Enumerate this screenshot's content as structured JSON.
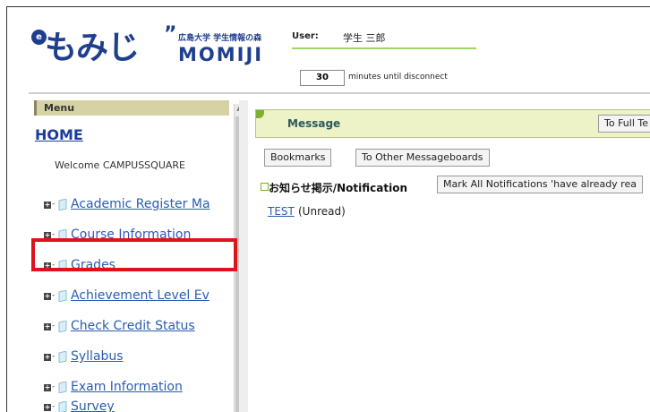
{
  "header": {
    "logo_mark": "e",
    "logo_kana": "もみじ",
    "logo_quote": "”",
    "logo_sub": "広島大学 学生情報の森",
    "logo_en": "MOMIJI",
    "user_label": "User:",
    "user_name": "学生 三郎",
    "timer_value": "30",
    "timer_text": "minutes until disconnect"
  },
  "sidebar": {
    "menu_title": "Menu",
    "home": "HOME",
    "welcome": "Welcome CAMPUSSQUARE",
    "items": [
      {
        "label": "Academic Register Ma"
      },
      {
        "label": "Course Information"
      },
      {
        "label": "Grades"
      },
      {
        "label": "Achievement Level Ev"
      },
      {
        "label": "Check Credit Status"
      },
      {
        "label": "Syllabus"
      },
      {
        "label": "Exam Information"
      },
      {
        "label": "Survey"
      }
    ],
    "plus_glyph": "+",
    "dash_glyph": "-"
  },
  "main": {
    "message_title": "Message",
    "full_text_button": "To Full Te",
    "bookmarks_button": "Bookmarks",
    "other_boards_button": "To Other Messageboards",
    "notification_label": "お知らせ掲示/Notification",
    "mark_all_button": "Mark All Notifications 'have already rea",
    "test_link": "TEST",
    "test_status": "(Unread)"
  },
  "colors": {
    "brand": "#1f3f8e",
    "link": "#2a5db0",
    "highlight": "#e0111b",
    "menu_header": "#d5d2a5",
    "message_bar": "#edf2c7"
  }
}
